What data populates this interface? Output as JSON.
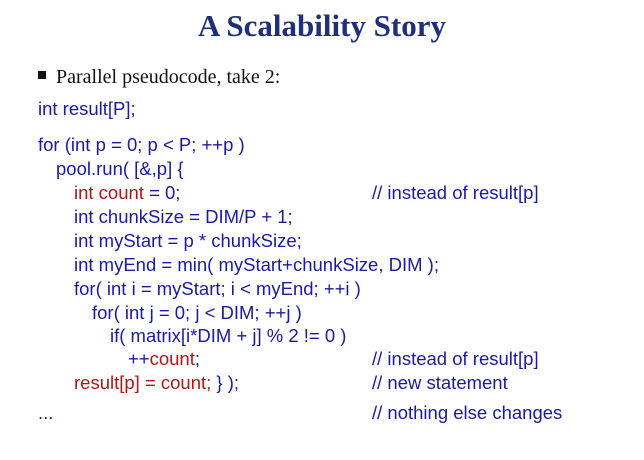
{
  "title": "A Scalability Story",
  "bullet": "Parallel pseudocode, take 2:",
  "code": {
    "l1": "int result[P];",
    "l2": "for (int p = 0; p < P; ++p )",
    "l3": "pool.run( [&,p] {",
    "l4_red": "int count",
    "l4_rest": " = 0;",
    "l4_comment": "// instead of result[p]",
    "l5": "int chunkSize = DIM/P + 1;",
    "l6": "int myStart = p * chunkSize;",
    "l7": "int myEnd = min( myStart+chunkSize, DIM );",
    "l8": "for( int i = myStart; i < myEnd; ++i )",
    "l9": "for( int j = 0; j < DIM; ++j )",
    "l10": "if( matrix[i*DIM + j] % 2 != 0 )",
    "l11_plain": "++",
    "l11_red": "count",
    "l11_rest": ";",
    "l11_comment": "// instead of result[p]",
    "l12_red": "result[p] = count;",
    "l12_rest": " } );",
    "l12_comment": "// new statement",
    "l13": "...",
    "l13_comment": "// nothing else changes"
  }
}
